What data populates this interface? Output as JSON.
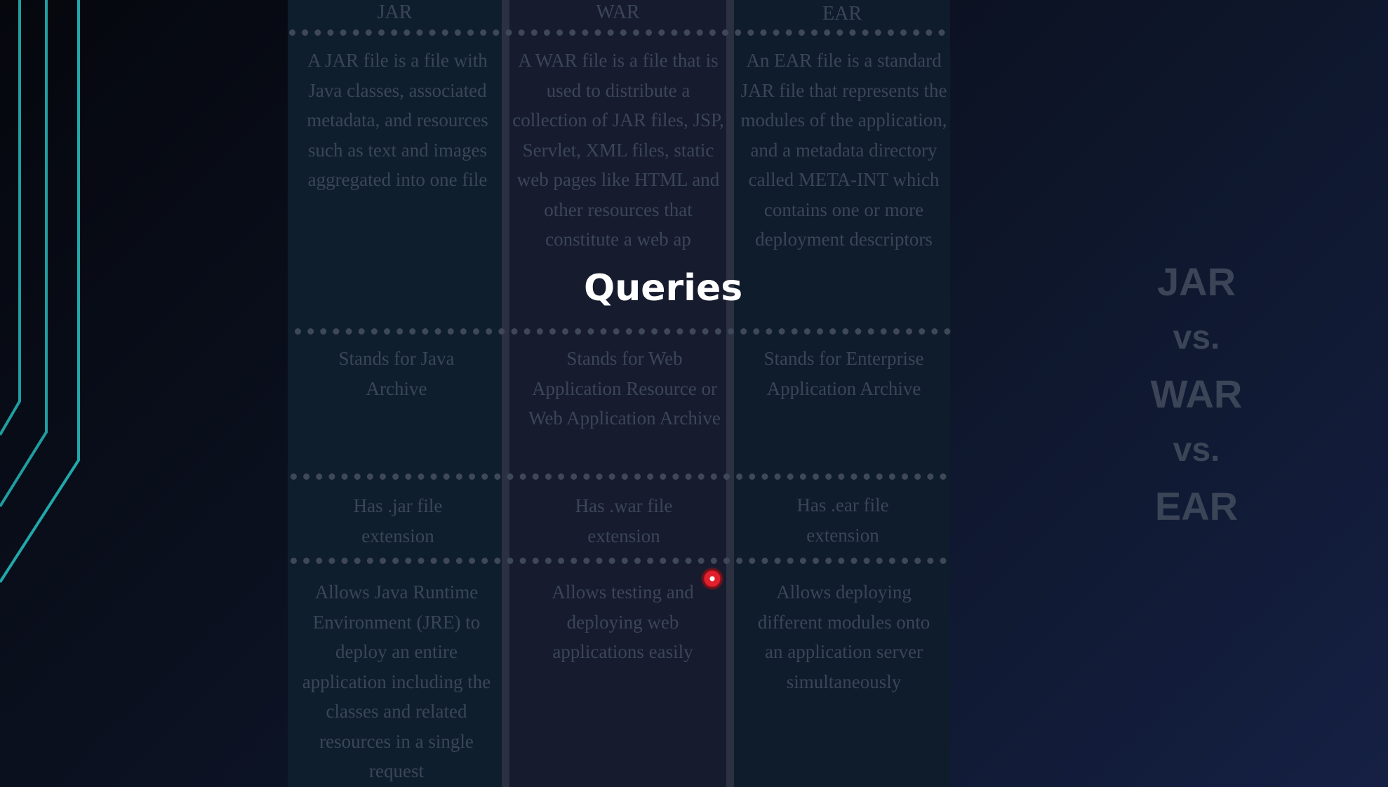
{
  "overlay_title": "Queries",
  "side_title": [
    "JAR",
    "vs.",
    "WAR",
    "vs.",
    "EAR"
  ],
  "table": {
    "headers": [
      "JAR",
      "WAR",
      "EAR"
    ],
    "rows": [
      {
        "jar": "A JAR file is a file with Java classes, associated metadata, and resources such as text and images aggregated into one file",
        "war": "A WAR file is a file that is used to distribute a collection of JAR files, JSP, Servlet, XML files, static web pages like HTML and other resources that constitute a web ap",
        "ear": "An EAR file is a standard JAR file that represents the modules of the application, and a metadata directory called META-INT which contains one or more deployment descriptors"
      },
      {
        "jar": "Stands for Java Archive",
        "war": "Stands for Web Application Resource or Web Application Archive",
        "ear": "Stands for Enterprise Application Archive"
      },
      {
        "jar": "Has .jar file extension",
        "war": "Has .war file extension",
        "ear": "Has .ear file extension"
      },
      {
        "jar": "Allows Java Runtime Environment (JRE) to deploy an entire application including the classes and related resources in a single request",
        "war": "Allows testing and deploying web applications easily",
        "ear": "Allows deploying different modules onto an application server simultaneously"
      }
    ]
  },
  "colors": {
    "background": "#0b1120",
    "accent_lines": "#1f9ea0",
    "table_text": "#3a4658",
    "overlay_text": "#ffffff",
    "pointer": "#e0202c"
  }
}
